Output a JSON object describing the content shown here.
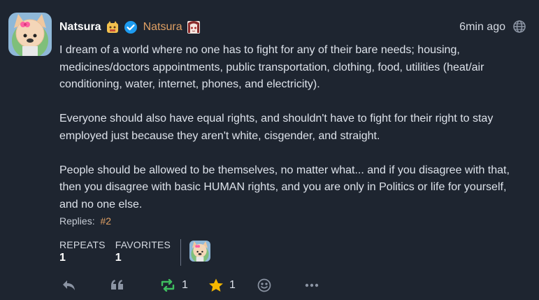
{
  "post": {
    "display_name": "Natsura",
    "username": "Natsura",
    "timestamp": "6min ago",
    "paragraphs": [
      "I dream of a world where no one has to fight for any of their bare needs; housing, medicines/doctors appointments, public transportation, clothing, food, utilities (heat/air conditioning, water, internet, phones, and electricity).",
      "Everyone should also have equal rights, and shouldn't have to fight for their right to stay employed just because they aren't white, cisgender, and straight.",
      "People should be allowed to be themselves, no matter what... and if you disagree with that, then you disagree with basic HUMAN rights, and you are only in Politics or life for yourself, and no one else."
    ],
    "replies_label": "Replies:",
    "replies_link": "#2"
  },
  "stats": {
    "repeats_label": "REPEATS",
    "repeats_value": "1",
    "favorites_label": "FAVORITES",
    "favorites_value": "1"
  },
  "actions": {
    "repeat_count": "1",
    "favorite_count": "1"
  },
  "icons": {
    "reply": "reply-icon",
    "quote": "quote-icon",
    "repeat": "repeat-icon",
    "favorite": "star-icon",
    "react": "emoji-icon",
    "more": "more-icon",
    "visibility": "globe-icon",
    "verified": "verified-badge-icon"
  },
  "colors": {
    "background": "#1e2530",
    "accent": "#e0a064",
    "repeat": "#3fbf5f",
    "favorite": "#f5b800",
    "verified": "#1d9bf0"
  }
}
